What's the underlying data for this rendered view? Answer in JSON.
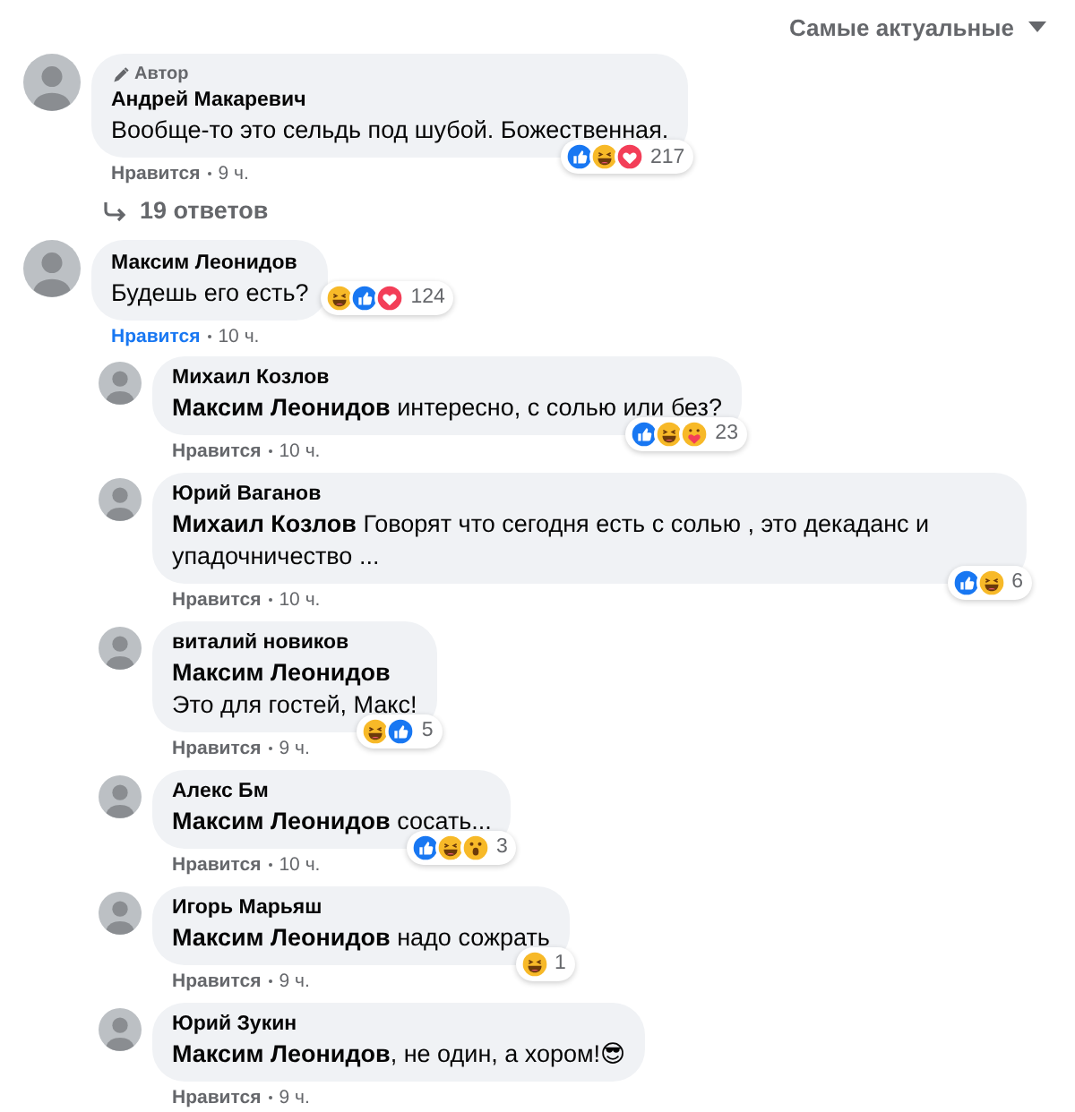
{
  "sort": {
    "label": "Самые актуальные"
  },
  "comments": [
    {
      "author": "Андрей Макаревич",
      "badge": "Автор",
      "lines": [
        "Вообще-то это сельдь под шубой. Божественная."
      ],
      "reactions": [
        {
          "kind": "like"
        },
        {
          "kind": "haha"
        },
        {
          "kind": "love"
        }
      ],
      "reaction_count": "217",
      "like_label": "Нравится",
      "liked": false,
      "time": "9 ч.",
      "replies_link": "19 ответов"
    },
    {
      "author": "Максим Леонидов",
      "lines": [
        "Будешь его есть?"
      ],
      "reactions": [
        {
          "kind": "haha"
        },
        {
          "kind": "like"
        },
        {
          "kind": "love"
        }
      ],
      "reaction_count": "124",
      "like_label": "Нравится",
      "liked": true,
      "time": "10 ч.",
      "children": [
        {
          "author": "Михаил Козлов",
          "lines": [
            "**Максим Леонидов** интересно, с солью или без?"
          ],
          "reactions": [
            {
              "kind": "like"
            },
            {
              "kind": "haha"
            },
            {
              "kind": "care"
            }
          ],
          "reaction_count": "23",
          "like_label": "Нравится",
          "liked": false,
          "time": "10 ч."
        },
        {
          "author": "Юрий Ваганов",
          "lines": [
            "**Михаил Козлов** Говорят что сегодня есть с солью , это декаданс и упадочничество ..."
          ],
          "reactions": [
            {
              "kind": "like"
            },
            {
              "kind": "haha"
            }
          ],
          "reaction_count": "6",
          "like_label": "Нравится",
          "liked": false,
          "time": "10 ч."
        },
        {
          "author": "виталий новиков",
          "lines": [
            "**Максим Леонидов**",
            "Это для гостей, Макс!"
          ],
          "reactions": [
            {
              "kind": "haha"
            },
            {
              "kind": "like"
            }
          ],
          "reaction_count": "5",
          "like_label": "Нравится",
          "liked": false,
          "time": "9 ч."
        },
        {
          "author": "Алекс Бм",
          "lines": [
            "**Максим Леонидов** сосать..."
          ],
          "reactions": [
            {
              "kind": "like"
            },
            {
              "kind": "haha"
            },
            {
              "kind": "wow"
            }
          ],
          "reaction_count": "3",
          "like_label": "Нравится",
          "liked": false,
          "time": "10 ч."
        },
        {
          "author": "Игорь Марьяш",
          "lines": [
            "**Максим Леонидов** надо сожрать"
          ],
          "reactions": [
            {
              "kind": "haha"
            }
          ],
          "reaction_count": "1",
          "like_label": "Нравится",
          "liked": false,
          "time": "9 ч."
        },
        {
          "author": "Юрий Зукин",
          "lines": [
            "**Максим Леонидов**, не один, а хором!😎"
          ],
          "like_label": "Нравится",
          "liked": false,
          "time": "9 ч."
        }
      ]
    }
  ]
}
